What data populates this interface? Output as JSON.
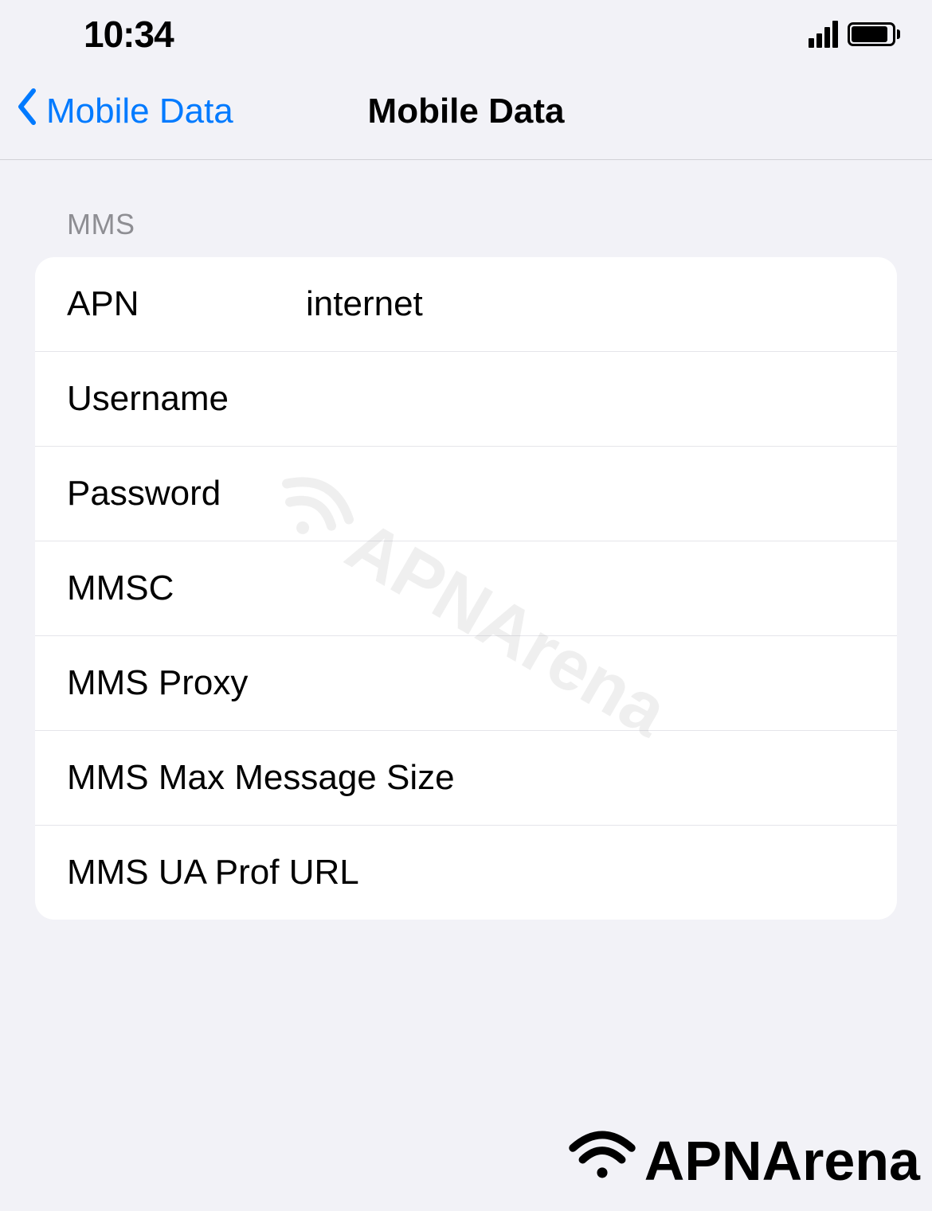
{
  "status_bar": {
    "time": "10:34"
  },
  "nav": {
    "back_label": "Mobile Data",
    "title": "Mobile Data"
  },
  "section": {
    "header": "MMS",
    "rows": [
      {
        "label": "APN",
        "value": "internet"
      },
      {
        "label": "Username",
        "value": ""
      },
      {
        "label": "Password",
        "value": ""
      },
      {
        "label": "MMSC",
        "value": ""
      },
      {
        "label": "MMS Proxy",
        "value": ""
      },
      {
        "label": "MMS Max Message Size",
        "value": ""
      },
      {
        "label": "MMS UA Prof URL",
        "value": ""
      }
    ]
  },
  "watermark": "APNArena",
  "logo": "APNArena"
}
